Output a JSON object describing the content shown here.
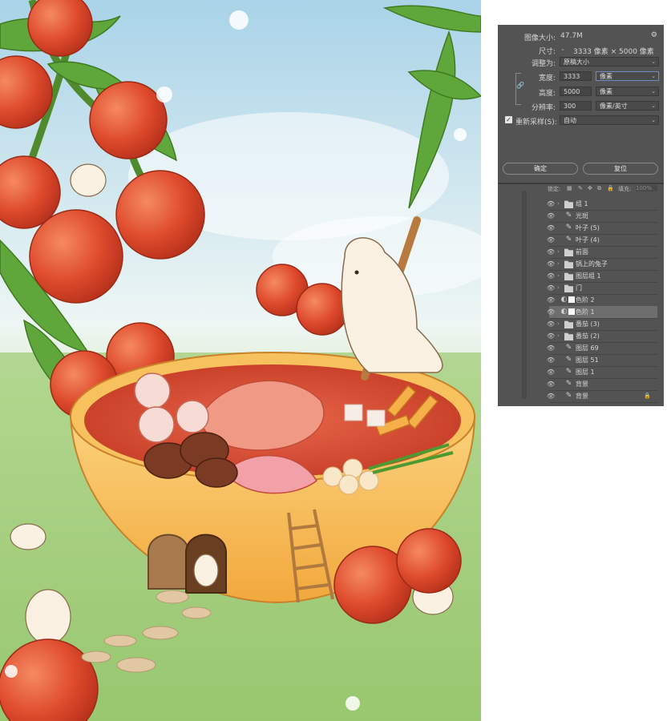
{
  "dialog": {
    "image_size_label": "图像大小:",
    "image_size_value": "47.7M",
    "dimensions_label": "尺寸:",
    "dimensions_value": "3333 像素 × 5000 像素",
    "fit_label": "调整为:",
    "fit_value": "原稿大小",
    "width_label": "宽度:",
    "width_value": "3333",
    "width_unit": "像素",
    "height_label": "高度:",
    "height_value": "5000",
    "height_unit": "像素",
    "resolution_label": "分辨率:",
    "resolution_value": "300",
    "resolution_unit": "像素/英寸",
    "resample_label": "重新采样(S):",
    "resample_checked": true,
    "resample_value": "自动",
    "ok_label": "确定",
    "reset_label": "复位"
  },
  "layers_panel": {
    "lock_label": "锁定:",
    "fill_label": "填充:",
    "fill_value": "100%",
    "layers": [
      {
        "name": "组 1",
        "type": "folder"
      },
      {
        "name": "光斑",
        "type": "brush"
      },
      {
        "name": "叶子 (5)",
        "type": "brush"
      },
      {
        "name": "叶子 (4)",
        "type": "brush"
      },
      {
        "name": "前面",
        "type": "folder"
      },
      {
        "name": "锅上的兔子",
        "type": "folder"
      },
      {
        "name": "图层组 1",
        "type": "folder"
      },
      {
        "name": "门",
        "type": "folder"
      },
      {
        "name": "色阶 2",
        "type": "adjustment"
      },
      {
        "name": "色阶 1",
        "type": "adjustment",
        "selected": true
      },
      {
        "name": "番茄 (3)",
        "type": "folder"
      },
      {
        "name": "番茄 (2)",
        "type": "folder"
      },
      {
        "name": "图层 69",
        "type": "brush"
      },
      {
        "name": "图层 51",
        "type": "brush"
      },
      {
        "name": "图层 1",
        "type": "brush"
      },
      {
        "name": "背景",
        "type": "brush"
      },
      {
        "name": "背景",
        "type": "brush",
        "locked": true
      }
    ]
  },
  "colors": {
    "panel_bg": "#535353",
    "accent": "#6c8ebf",
    "tomato": "#d94b2b",
    "leaf": "#5a9a3a",
    "bowl": "#f3b54a"
  }
}
